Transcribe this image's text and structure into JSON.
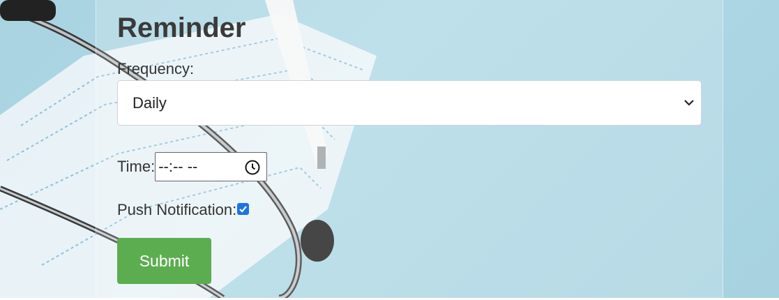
{
  "form": {
    "title": "Reminder",
    "frequency_label": "Frequency:",
    "frequency_value": "Daily",
    "time_label": "Time:",
    "time_value": "--:-- --",
    "push_label": "Push Notification:",
    "push_checked": true,
    "submit_label": "Submit"
  },
  "colors": {
    "background": "#a9d3e0",
    "submit": "#5cad4f",
    "checkbox": "#1a73e8"
  },
  "icons": {
    "select_arrow": "chevron-down-icon",
    "time_picker": "clock-icon",
    "checkbox": "check-icon"
  }
}
